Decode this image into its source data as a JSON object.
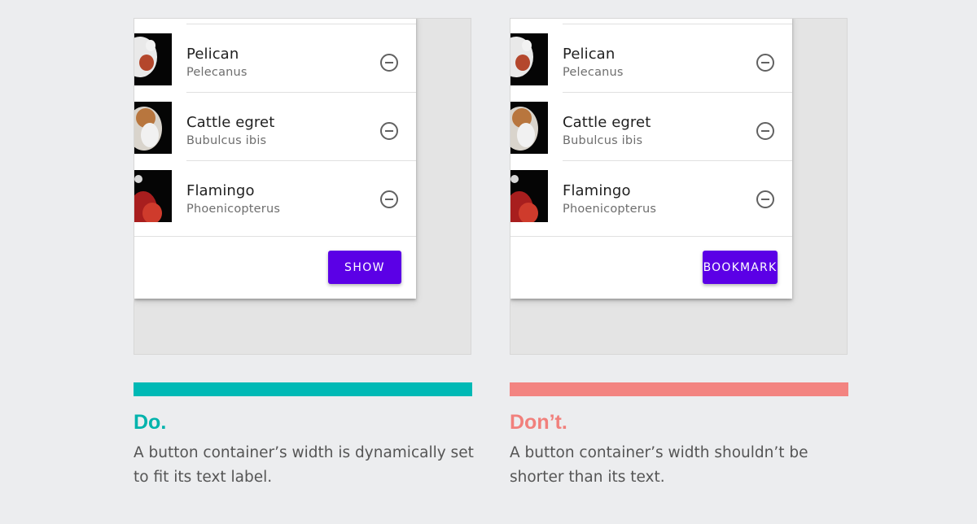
{
  "do_panel": {
    "list": [
      {
        "title": "Pelican",
        "subtitle": "Pelecanus"
      },
      {
        "title": "Cattle egret",
        "subtitle": "Bubulcus ibis"
      },
      {
        "title": "Flamingo",
        "subtitle": "Phoenicopterus"
      }
    ],
    "button_label": "SHOW",
    "heading": "Do.",
    "description": "A button container’s width is dynamically set to fit its text label.",
    "accent_color": "#00b9b5"
  },
  "dont_panel": {
    "list": [
      {
        "title": "Pelican",
        "subtitle": "Pelecanus"
      },
      {
        "title": "Cattle egret",
        "subtitle": "Bubulcus ibis"
      },
      {
        "title": "Flamingo",
        "subtitle": "Phoenicopterus"
      }
    ],
    "button_label": "BOOKMARK",
    "heading": "Don’t.",
    "description": "A button container’s width shouldn’t be shorter than its text.",
    "accent_color": "#f38481"
  },
  "icons": {
    "remove": "remove-circle-icon"
  },
  "colors": {
    "button": "#5b00e6"
  }
}
